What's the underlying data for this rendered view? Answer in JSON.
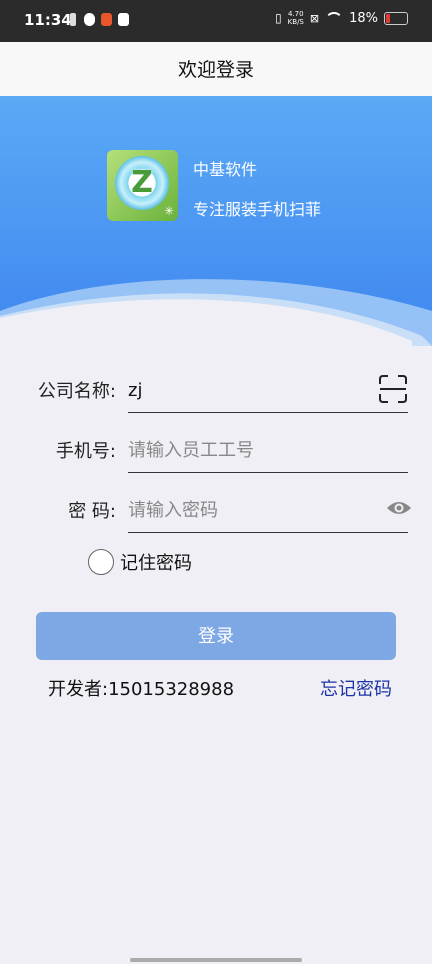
{
  "status_bar": {
    "time": "11:34",
    "net_speed_value": "4.70",
    "net_speed_unit": "KB/S",
    "battery_text": "18%",
    "colors": {
      "battery_low": "#e53935"
    }
  },
  "header": {
    "title": "欢迎登录"
  },
  "hero": {
    "line1": "中基软件",
    "line2": "专注服装手机扫菲",
    "logo_letter": "Z",
    "colors": {
      "top": "#5aaaf6",
      "bottom": "#4189f0"
    }
  },
  "form": {
    "company": {
      "label": "公司名称:",
      "value": "zj",
      "icon": "scan-icon"
    },
    "phone": {
      "label": "手机号:",
      "placeholder": "请输入员工工号"
    },
    "password": {
      "label": "密 码:",
      "placeholder": "请输入密码",
      "icon": "eye-icon"
    },
    "remember": {
      "label": "记住密码",
      "checked": false
    }
  },
  "login_button": {
    "label": "登录",
    "color": "#7ea8e4"
  },
  "footer": {
    "developer": "开发者:15015328988",
    "forgot_password": "忘记密码",
    "link_color": "#1d34a8"
  }
}
